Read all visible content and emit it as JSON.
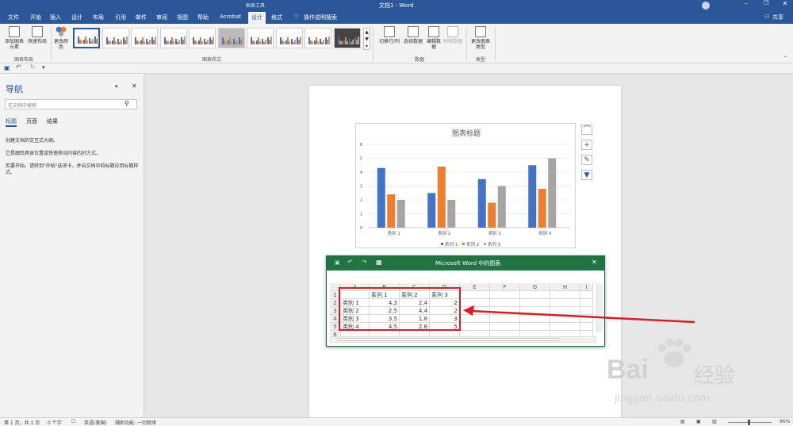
{
  "titlebar": {
    "chart_tools": "图表工具",
    "doc_title": "文档1 - Word"
  },
  "tabs": [
    "文件",
    "开始",
    "插入",
    "设计",
    "布局",
    "引用",
    "邮件",
    "审阅",
    "视图",
    "帮助",
    "Acrobat",
    "设计",
    "格式"
  ],
  "active_tab_index": 11,
  "tell_me": "操作说明搜索",
  "share": "共享",
  "ribbon": {
    "add_chart_element": "添加图表元素",
    "quick_layout": "快速布局",
    "layout_group": "图表布局",
    "change_colors": "更改颜色",
    "styles_group": "图表样式",
    "switch_row_col": "切换行/列",
    "select_data": "选择数据",
    "edit_data": "编辑数据",
    "refresh_data": "刷新数据",
    "data_group": "数据",
    "change_type": "更改图表类型",
    "type_group": "类型"
  },
  "nav": {
    "title": "导航",
    "search_placeholder": "在文档中搜索",
    "tabs": [
      "标题",
      "页面",
      "结果"
    ],
    "para1": "创建文档的交互式大纲。",
    "para2": "它是跟踪具体位置或快速移动内容的好方式。",
    "para3": "若要开始，请转到\"开始\"选项卡，并向文档中的标题应用标题样式。"
  },
  "chart_data": {
    "type": "bar",
    "title": "图表标题",
    "categories": [
      "类别 1",
      "类别 2",
      "类别 3",
      "类别 4"
    ],
    "series": [
      {
        "name": "系列 1",
        "values": [
          4.3,
          2.5,
          3.5,
          4.5
        ],
        "color": "#4472c4"
      },
      {
        "name": "系列 2",
        "values": [
          2.4,
          4.4,
          1.8,
          2.8
        ],
        "color": "#ed7d31"
      },
      {
        "name": "系列 3",
        "values": [
          2,
          2,
          3,
          5
        ],
        "color": "#a5a5a5"
      }
    ],
    "yticks": [
      "0",
      "1",
      "2",
      "3",
      "4",
      "5",
      "6"
    ],
    "ylim": [
      0,
      6
    ],
    "legend": "bottom"
  },
  "sheet": {
    "title": "Microsoft Word 中的图表",
    "col_headers": [
      "A",
      "B",
      "C",
      "D",
      "E",
      "F",
      "G",
      "H",
      "I"
    ],
    "row_headers": [
      "1",
      "2",
      "3",
      "4",
      "5",
      "6"
    ],
    "rows": [
      [
        "",
        "系列 1",
        "系列 2",
        "系列 3"
      ],
      [
        "类别 1",
        "4.3",
        "2.4",
        "2"
      ],
      [
        "类别 2",
        "2.5",
        "4.4",
        "2"
      ],
      [
        "类别 3",
        "3.5",
        "1.8",
        "3"
      ],
      [
        "类别 4",
        "4.5",
        "2.8",
        "5"
      ]
    ]
  },
  "status": {
    "page": "第 1 页，共 1 页",
    "words": "0 个字",
    "lang": "英语(美国)",
    "accessibility": "辅助功能: 一切就绪",
    "zoom": "96%"
  },
  "watermark": {
    "brand": "Bai",
    "brand2": "经验",
    "url": "jingyan.baidu.com"
  },
  "colors": {
    "word_blue": "#2b579a",
    "excel_green": "#217346",
    "highlight_red": "#d0202a"
  }
}
